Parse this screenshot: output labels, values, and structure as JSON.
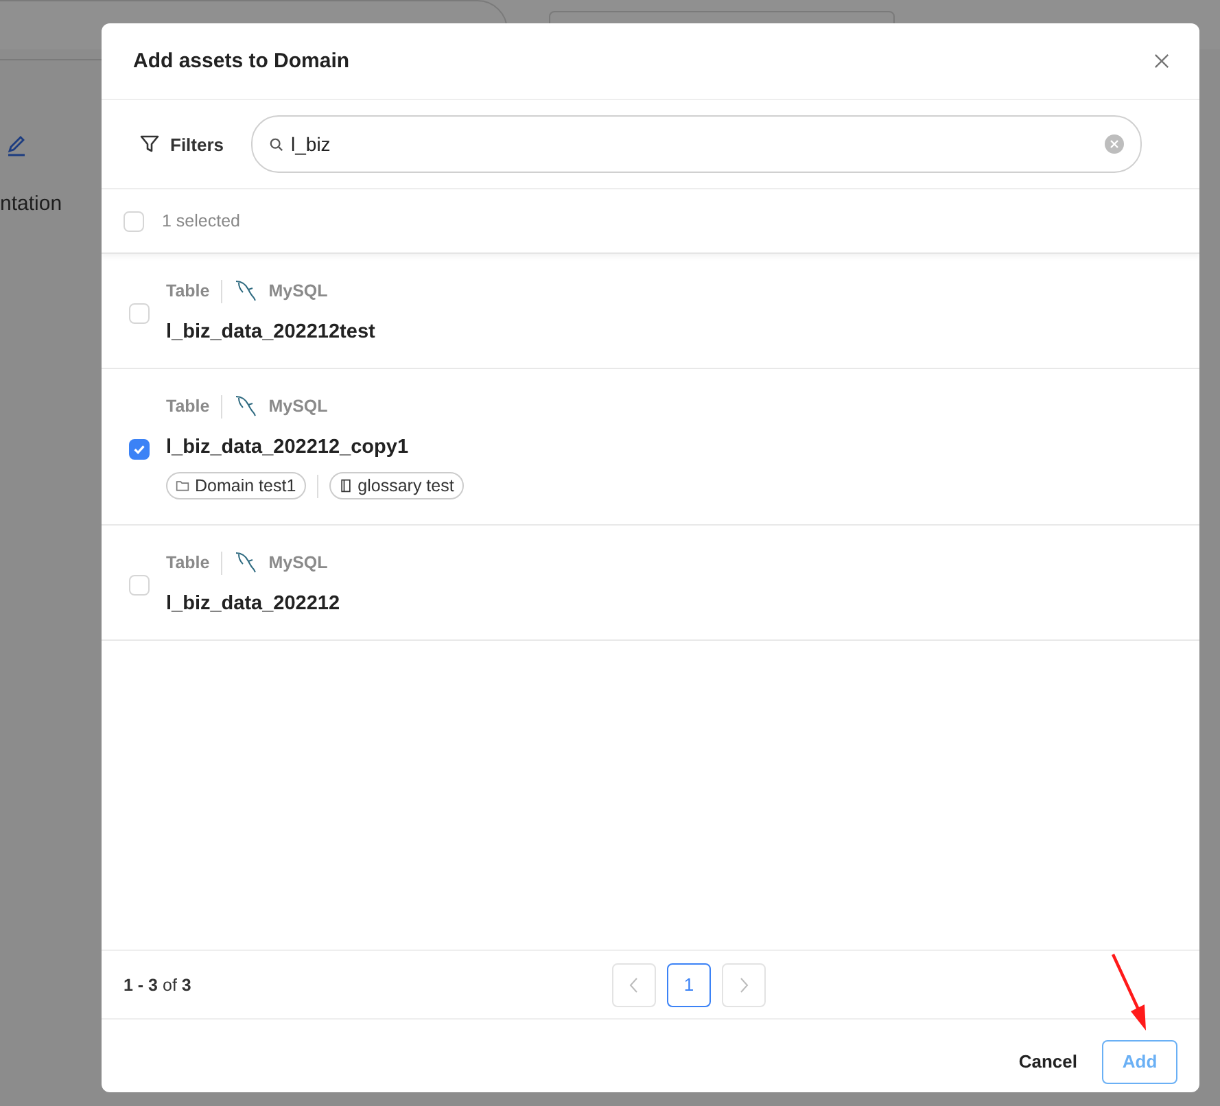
{
  "background": {
    "side_text": "ntation"
  },
  "dialog": {
    "title": "Add assets to Domain",
    "filters_label": "Filters",
    "search": {
      "value": "l_biz"
    },
    "select_all": {
      "checked": false,
      "label": "1 selected"
    },
    "assets": [
      {
        "type": "Table",
        "service": "MySQL",
        "name": "l_biz_data_202212test",
        "checked": false
      },
      {
        "type": "Table",
        "service": "MySQL",
        "name": "l_biz_data_202212_copy1",
        "checked": true,
        "tags": [
          {
            "kind": "domain",
            "label": "Domain test1"
          },
          {
            "kind": "glossary",
            "label": "glossary test"
          }
        ]
      },
      {
        "type": "Table",
        "service": "MySQL",
        "name": "l_biz_data_202212",
        "checked": false
      }
    ],
    "pagination": {
      "summary": "**1 - 3** of **3**",
      "pages": [
        {
          "label": "1",
          "selected": true
        }
      ]
    },
    "buttons": [
      {
        "kind": "cancel",
        "label": "Cancel"
      },
      {
        "kind": "add",
        "label": "Add"
      }
    ]
  }
}
